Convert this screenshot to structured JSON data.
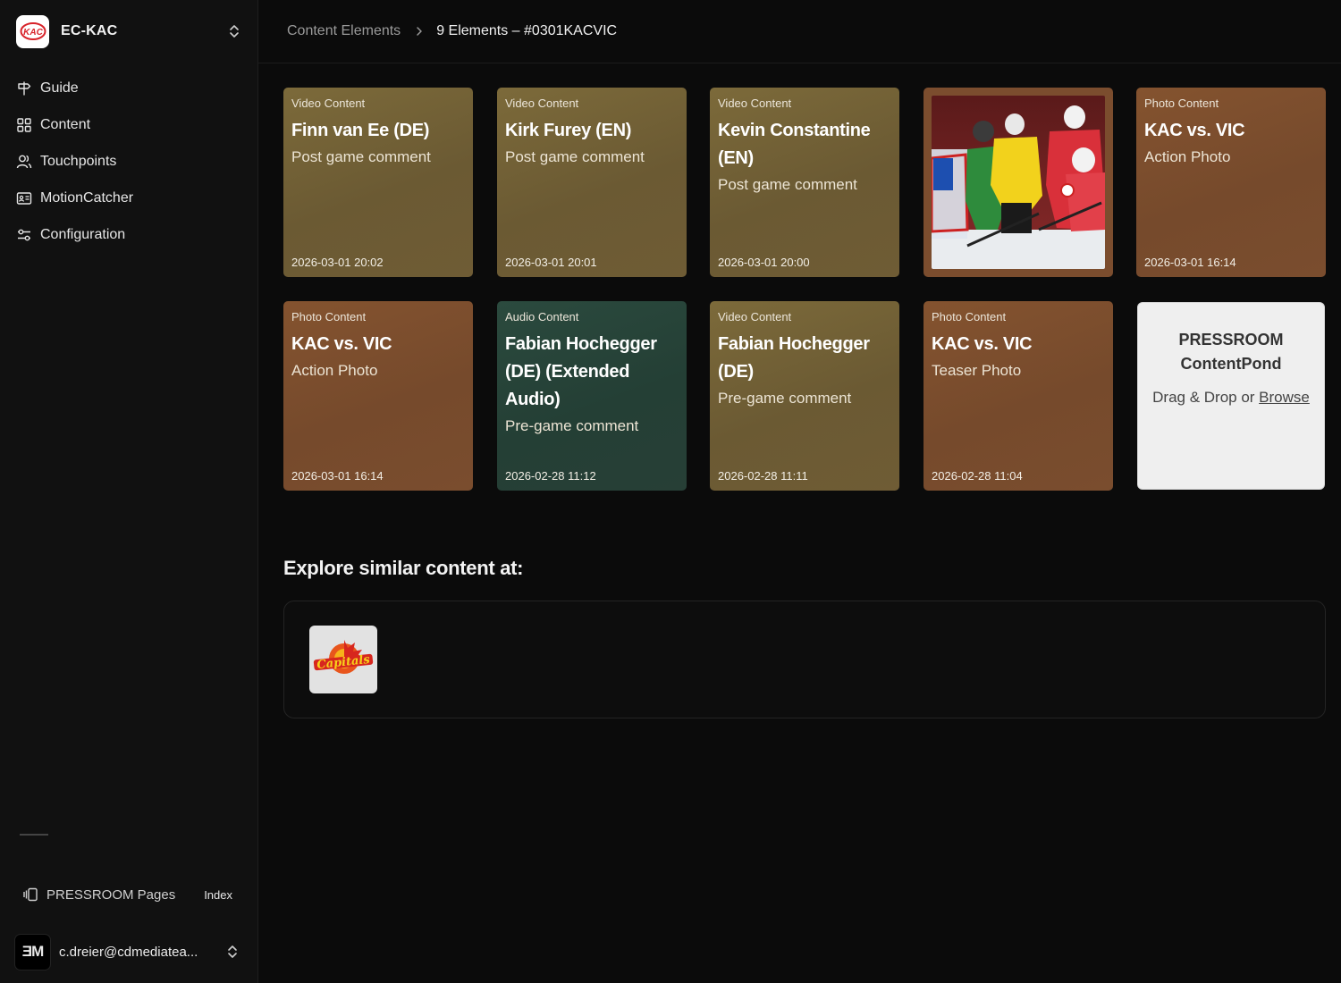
{
  "org": {
    "name": "EC-KAC",
    "logo_text": "KAC"
  },
  "nav": {
    "items": [
      {
        "label": "Guide",
        "icon": "signpost-icon"
      },
      {
        "label": "Content",
        "icon": "grid-icon"
      },
      {
        "label": "Touchpoints",
        "icon": "users-icon"
      },
      {
        "label": "MotionCatcher",
        "icon": "id-card-icon"
      },
      {
        "label": "Configuration",
        "icon": "sliders-icon"
      }
    ]
  },
  "pages": {
    "label": "PRESSROOM Pages",
    "index_label": "Index"
  },
  "user": {
    "email": "c.dreier@cdmediatea...",
    "avatar_text": "ƎM"
  },
  "breadcrumb": {
    "parent": "Content Elements",
    "current": "9 Elements – #0301KACVIC"
  },
  "cards": [
    {
      "type": "Video Content",
      "title": "Finn van Ee (DE)",
      "subtitle": "Post game comment",
      "date": "2026-03-01 20:02"
    },
    {
      "type": "Video Content",
      "title": "Kirk Furey (EN)",
      "subtitle": "Post game comment",
      "date": "2026-03-01 20:01"
    },
    {
      "type": "Video Content",
      "title": "Kevin Constantine (EN)",
      "subtitle": "Post game comment",
      "date": "2026-03-01 20:00"
    },
    {
      "type": "Photo Content",
      "title": "KAC vs. VIC",
      "subtitle": "Action Photo",
      "date": "2026-03-01 16:14"
    },
    {
      "type": "Photo Content",
      "title": "KAC vs. VIC",
      "subtitle": "Action Photo",
      "date": "2026-03-01 16:14"
    },
    {
      "type": "Audio Content",
      "title": "Fabian Hochegger (DE) (Extended Audio)",
      "subtitle": "Pre-game comment",
      "date": "2026-02-28 11:12"
    },
    {
      "type": "Video Content",
      "title": "Fabian Hochegger (DE)",
      "subtitle": "Pre-game comment",
      "date": "2026-02-28 11:11"
    },
    {
      "type": "Photo Content",
      "title": "KAC vs. VIC",
      "subtitle": "Teaser Photo",
      "date": "2026-02-28 11:04"
    }
  ],
  "dropzone": {
    "title_line1": "PRESSROOM",
    "title_line2": "ContentPond",
    "text": "Drag & Drop or ",
    "browse": "Browse"
  },
  "explore": {
    "title": "Explore similar content at:",
    "partner_logo_text": "Capitals"
  },
  "colors": {
    "video": "#7a6839",
    "photo": "#7e5030",
    "audio": "#294639",
    "brand_red": "#d8232a"
  }
}
